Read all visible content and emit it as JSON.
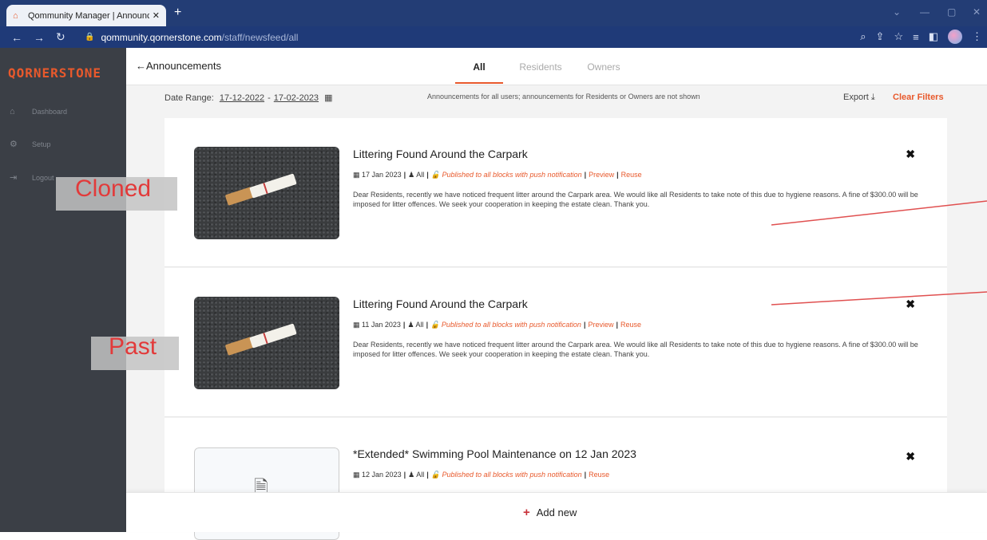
{
  "browser": {
    "tab_title": "Qommunity Manager | Announce",
    "tab_close": "✕",
    "new_tab": "+",
    "url_domain": "qommunity.qornerstone.com",
    "url_path": "/staff/newsfeed/all"
  },
  "sidebar": {
    "brand": "QORNERSTONE",
    "items": [
      {
        "label": "Dashboard"
      },
      {
        "label": "Setup"
      },
      {
        "label": "Logout"
      }
    ]
  },
  "header": {
    "back_label": "Announcements",
    "tabs": [
      {
        "label": "All",
        "active": true
      },
      {
        "label": "Residents",
        "active": false
      },
      {
        "label": "Owners",
        "active": false
      }
    ]
  },
  "filter": {
    "date_range_label": "Date Range:",
    "date_from": "17-12-2022",
    "date_to": "17-02-2023",
    "note": "Announcements for all users; announcements for Residents or Owners are not shown",
    "export_label": "Export",
    "clear_label": "Clear Filters"
  },
  "announcements": [
    {
      "title": "Littering Found Around the Carpark",
      "date": "17 Jan 2023",
      "audience": "All",
      "status": "Published to all blocks with push notification",
      "preview": "Preview",
      "reuse": "Reuse",
      "body": "Dear Residents, recently we have noticed frequent litter around the Carpark area. We would like all Residents to take note of this due to hygiene reasons. A fine of $300.00 will be imposed for litter offences. We seek your cooperation in keeping the estate clean. Thank you."
    },
    {
      "title": "Littering Found Around the Carpark",
      "date": "11 Jan 2023",
      "audience": "All",
      "status": "Published to all blocks with push notification",
      "preview": "Preview",
      "reuse": "Reuse",
      "body": "Dear Residents, recently we have noticed frequent litter around the Carpark area. We would like all Residents to take note of this due to hygiene reasons. A fine of $300.00 will be imposed for litter offences. We seek your cooperation in keeping the estate clean. Thank you."
    },
    {
      "title": "*Extended* Swimming Pool Maintenance on 12 Jan 2023",
      "date": "12 Jan 2023",
      "audience": "All",
      "status": "Published to all blocks with push notification",
      "reuse": "Reuse"
    }
  ],
  "annotations": {
    "cloned": "Cloned",
    "past": "Past"
  },
  "footer": {
    "add_new_label": "Add new"
  },
  "colors": {
    "accent": "#e8592c",
    "sidebar": "#3b3f46",
    "browser": "#233d75"
  }
}
